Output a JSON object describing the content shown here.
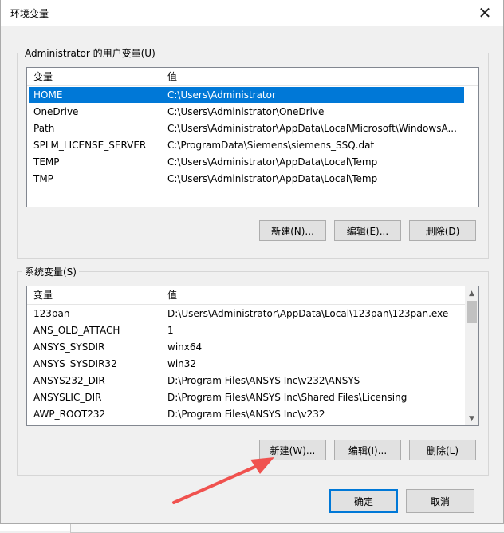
{
  "window": {
    "title": "环境变量",
    "close_symbol": "✕"
  },
  "user_vars": {
    "group_label": "Administrator 的用户变量(U)",
    "columns": [
      "变量",
      "值"
    ],
    "rows": [
      {
        "name": "HOME",
        "value": "C:\\Users\\Administrator",
        "selected": true
      },
      {
        "name": "OneDrive",
        "value": "C:\\Users\\Administrator\\OneDrive",
        "selected": false
      },
      {
        "name": "Path",
        "value": "C:\\Users\\Administrator\\AppData\\Local\\Microsoft\\WindowsA...",
        "selected": false
      },
      {
        "name": "SPLM_LICENSE_SERVER",
        "value": "C:\\ProgramData\\Siemens\\siemens_SSQ.dat",
        "selected": false
      },
      {
        "name": "TEMP",
        "value": "C:\\Users\\Administrator\\AppData\\Local\\Temp",
        "selected": false
      },
      {
        "name": "TMP",
        "value": "C:\\Users\\Administrator\\AppData\\Local\\Temp",
        "selected": false
      }
    ],
    "buttons": {
      "new": "新建(N)...",
      "edit": "编辑(E)...",
      "delete": "删除(D)"
    }
  },
  "system_vars": {
    "group_label": "系统变量(S)",
    "columns": [
      "变量",
      "值"
    ],
    "rows": [
      {
        "name": "123pan",
        "value": "D:\\Users\\Administrator\\AppData\\Local\\123pan\\123pan.exe"
      },
      {
        "name": "ANS_OLD_ATTACH",
        "value": "1"
      },
      {
        "name": "ANSYS_SYSDIR",
        "value": "winx64"
      },
      {
        "name": "ANSYS_SYSDIR32",
        "value": "win32"
      },
      {
        "name": "ANSYS232_DIR",
        "value": "D:\\Program Files\\ANSYS Inc\\v232\\ANSYS"
      },
      {
        "name": "ANSYSLIC_DIR",
        "value": "D:\\Program Files\\ANSYS Inc\\Shared Files\\Licensing"
      },
      {
        "name": "AWP_ROOT232",
        "value": "D:\\Program Files\\ANSYS Inc\\v232"
      }
    ],
    "buttons": {
      "new": "新建(W)...",
      "edit": "编辑(I)...",
      "delete": "删除(L)"
    }
  },
  "footer": {
    "ok": "确定",
    "cancel": "取消"
  },
  "annotation": {
    "color": "#f0524f"
  },
  "scrollbar": {
    "up_symbol": "▲",
    "down_symbol": "▼"
  }
}
